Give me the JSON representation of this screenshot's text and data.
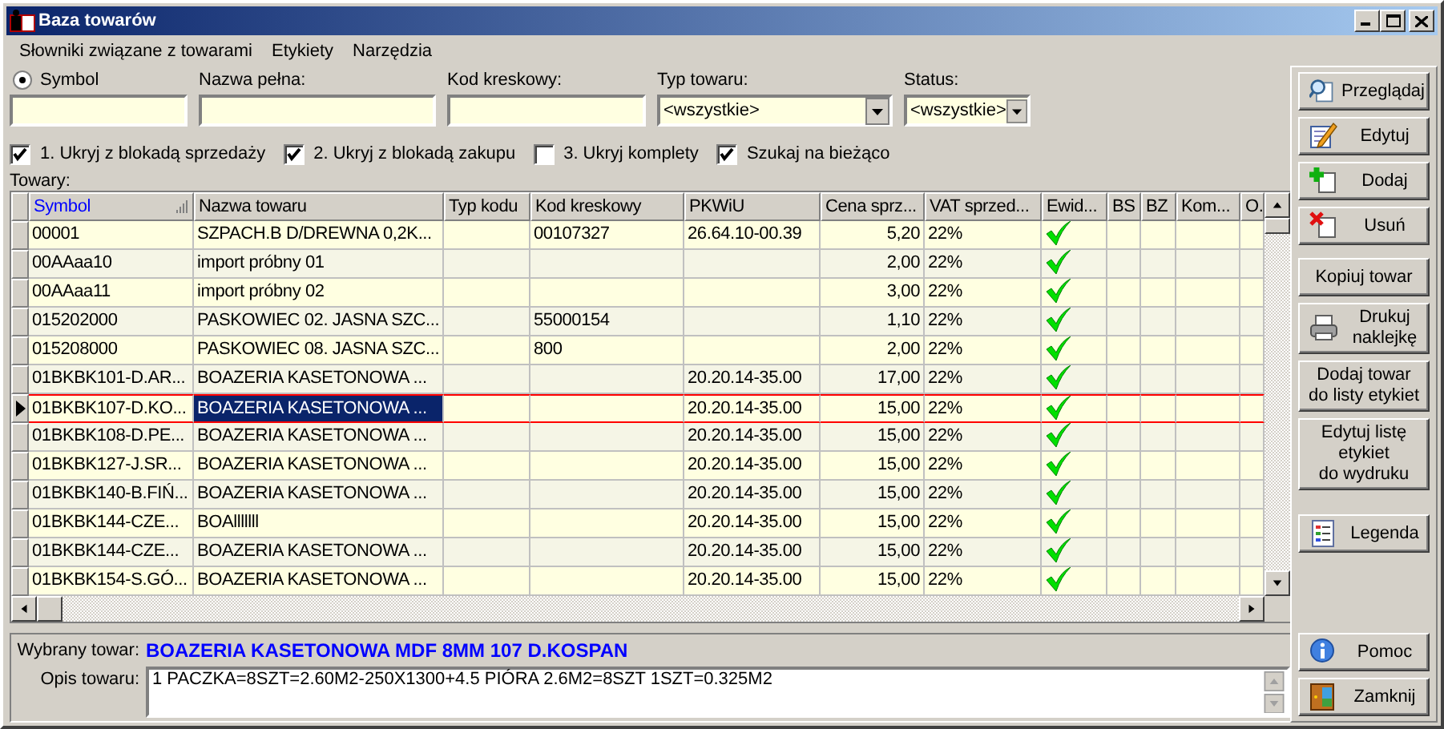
{
  "window": {
    "title": "Baza towarów"
  },
  "menu": [
    "Słowniki związane z towarami",
    "Etykiety",
    "Narzędzia"
  ],
  "filters": [
    {
      "label": "Symbol",
      "kind": "radio-text",
      "selected": true
    },
    {
      "label": "Nazwa pełna:",
      "kind": "text"
    },
    {
      "label": "Kod kreskowy:",
      "kind": "text"
    },
    {
      "label": "Typ towaru:",
      "kind": "select",
      "value": "<wszystkie>"
    },
    {
      "label": "Status:",
      "kind": "select",
      "value": "<wszystkie>"
    }
  ],
  "options": [
    {
      "label": "1. Ukryj z blokadą sprzedaży",
      "checked": true
    },
    {
      "label": "2. Ukryj z blokadą zakupu",
      "checked": true
    },
    {
      "label": "3. Ukryj komplety",
      "checked": false
    },
    {
      "label": "Szukaj na bieżąco",
      "checked": true
    }
  ],
  "table": {
    "label": "Towary:",
    "columns": [
      {
        "title": "Symbol",
        "kind": "text",
        "sorted": true,
        "focused": false
      },
      {
        "title": "Nazwa towaru",
        "kind": "text",
        "sorted": false,
        "focused": true
      },
      {
        "title": "Typ kodu",
        "kind": "text",
        "sorted": false,
        "focused": false
      },
      {
        "title": "Kod kreskowy",
        "kind": "text",
        "sorted": false,
        "focused": false
      },
      {
        "title": "PKWiU",
        "kind": "text",
        "sorted": false,
        "focused": false
      },
      {
        "title": "Cena sprz...",
        "kind": "number",
        "sorted": false,
        "focused": false
      },
      {
        "title": "VAT sprzed...",
        "kind": "text",
        "sorted": false,
        "focused": false
      },
      {
        "title": "Ewid...",
        "kind": "check",
        "sorted": false,
        "focused": false
      },
      {
        "title": "BS",
        "kind": "empty",
        "sorted": false,
        "focused": false
      },
      {
        "title": "BZ",
        "kind": "empty",
        "sorted": false,
        "focused": false
      },
      {
        "title": "Kom...",
        "kind": "empty",
        "sorted": false,
        "focused": false
      },
      {
        "title": "O.",
        "kind": "empty",
        "sorted": false,
        "focused": false
      }
    ],
    "rows": [
      {
        "cells": [
          "00001",
          "SZPACH.B D/DREWNA 0,2K...",
          "",
          "00107327",
          "26.64.10-00.39",
          "5,20",
          "22%"
        ],
        "ewid": true,
        "selected": false
      },
      {
        "cells": [
          "00AAaa10",
          "import próbny 01",
          "",
          "",
          "",
          "2,00",
          "22%"
        ],
        "ewid": true,
        "selected": false
      },
      {
        "cells": [
          "00AAaa11",
          "import próbny 02",
          "",
          "",
          "",
          "3,00",
          "22%"
        ],
        "ewid": true,
        "selected": false
      },
      {
        "cells": [
          "015202000",
          "PASKOWIEC 02. JASNA SZC...",
          "",
          "55000154",
          "",
          "1,10",
          "22%"
        ],
        "ewid": true,
        "selected": false
      },
      {
        "cells": [
          "015208000",
          "PASKOWIEC 08. JASNA SZC...",
          "",
          "800",
          "",
          "2,00",
          "22%"
        ],
        "ewid": true,
        "selected": false
      },
      {
        "cells": [
          "01BKBK101-D.AR...",
          "BOAZERIA KASETONOWA ...",
          "",
          "",
          "20.20.14-35.00",
          "17,00",
          "22%"
        ],
        "ewid": true,
        "selected": false
      },
      {
        "cells": [
          "01BKBK107-D.KO...",
          "BOAZERIA KASETONOWA ...",
          "",
          "",
          "20.20.14-35.00",
          "15,00",
          "22%"
        ],
        "ewid": true,
        "selected": true
      },
      {
        "cells": [
          "01BKBK108-D.PE...",
          "BOAZERIA KASETONOWA ...",
          "",
          "",
          "20.20.14-35.00",
          "15,00",
          "22%"
        ],
        "ewid": true,
        "selected": false
      },
      {
        "cells": [
          "01BKBK127-J.SR...",
          "BOAZERIA KASETONOWA ...",
          "",
          "",
          "20.20.14-35.00",
          "15,00",
          "22%"
        ],
        "ewid": true,
        "selected": false
      },
      {
        "cells": [
          "01BKBK140-B.FIŃ...",
          "BOAZERIA KASETONOWA ...",
          "",
          "",
          "20.20.14-35.00",
          "15,00",
          "22%"
        ],
        "ewid": true,
        "selected": false
      },
      {
        "cells": [
          "01BKBK144-CZE...",
          "BOAlllllll",
          "",
          "",
          "20.20.14-35.00",
          "15,00",
          "22%"
        ],
        "ewid": true,
        "selected": false
      },
      {
        "cells": [
          "01BKBK144-CZE...",
          "BOAZERIA KASETONOWA ...",
          "",
          "",
          "20.20.14-35.00",
          "15,00",
          "22%"
        ],
        "ewid": true,
        "selected": false
      },
      {
        "cells": [
          "01BKBK154-S.GÓ...",
          "BOAZERIA KASETONOWA ...",
          "",
          "",
          "20.20.14-35.00",
          "15,00",
          "22%"
        ],
        "ewid": true,
        "selected": false
      }
    ]
  },
  "details": {
    "selected_label": "Wybrany towar:",
    "selected_value": "BOAZERIA KASETONOWA MDF 8MM 107 D.KOSPAN",
    "description_label": "Opis towaru:",
    "description": "1 PACZKA=8SZT=2.60M2-250X1300+4.5 PIÓRA 2.6M2=8SZT 1SZT=0.325M2"
  },
  "button_groups": [
    [
      {
        "label": "Przeglądaj",
        "kind": "view"
      },
      {
        "label": "Edytuj",
        "kind": "edit"
      },
      {
        "label": "Dodaj",
        "kind": "add"
      },
      {
        "label": "Usuń",
        "kind": "delete"
      }
    ],
    [
      {
        "label": "Kopiuj towar",
        "kind": "plain"
      },
      {
        "label": "Drukuj\nnaklejkę",
        "kind": "print"
      },
      {
        "label": "Dodaj towar\ndo listy etykiet",
        "kind": "plain"
      },
      {
        "label": "Edytuj listę\netykiet\ndo wydruku",
        "kind": "plain"
      }
    ],
    [
      {
        "label": "Legenda",
        "kind": "legend"
      }
    ],
    [
      {
        "label": "Pomoc",
        "kind": "help"
      },
      {
        "label": "Zamknij",
        "kind": "exit"
      }
    ]
  ]
}
